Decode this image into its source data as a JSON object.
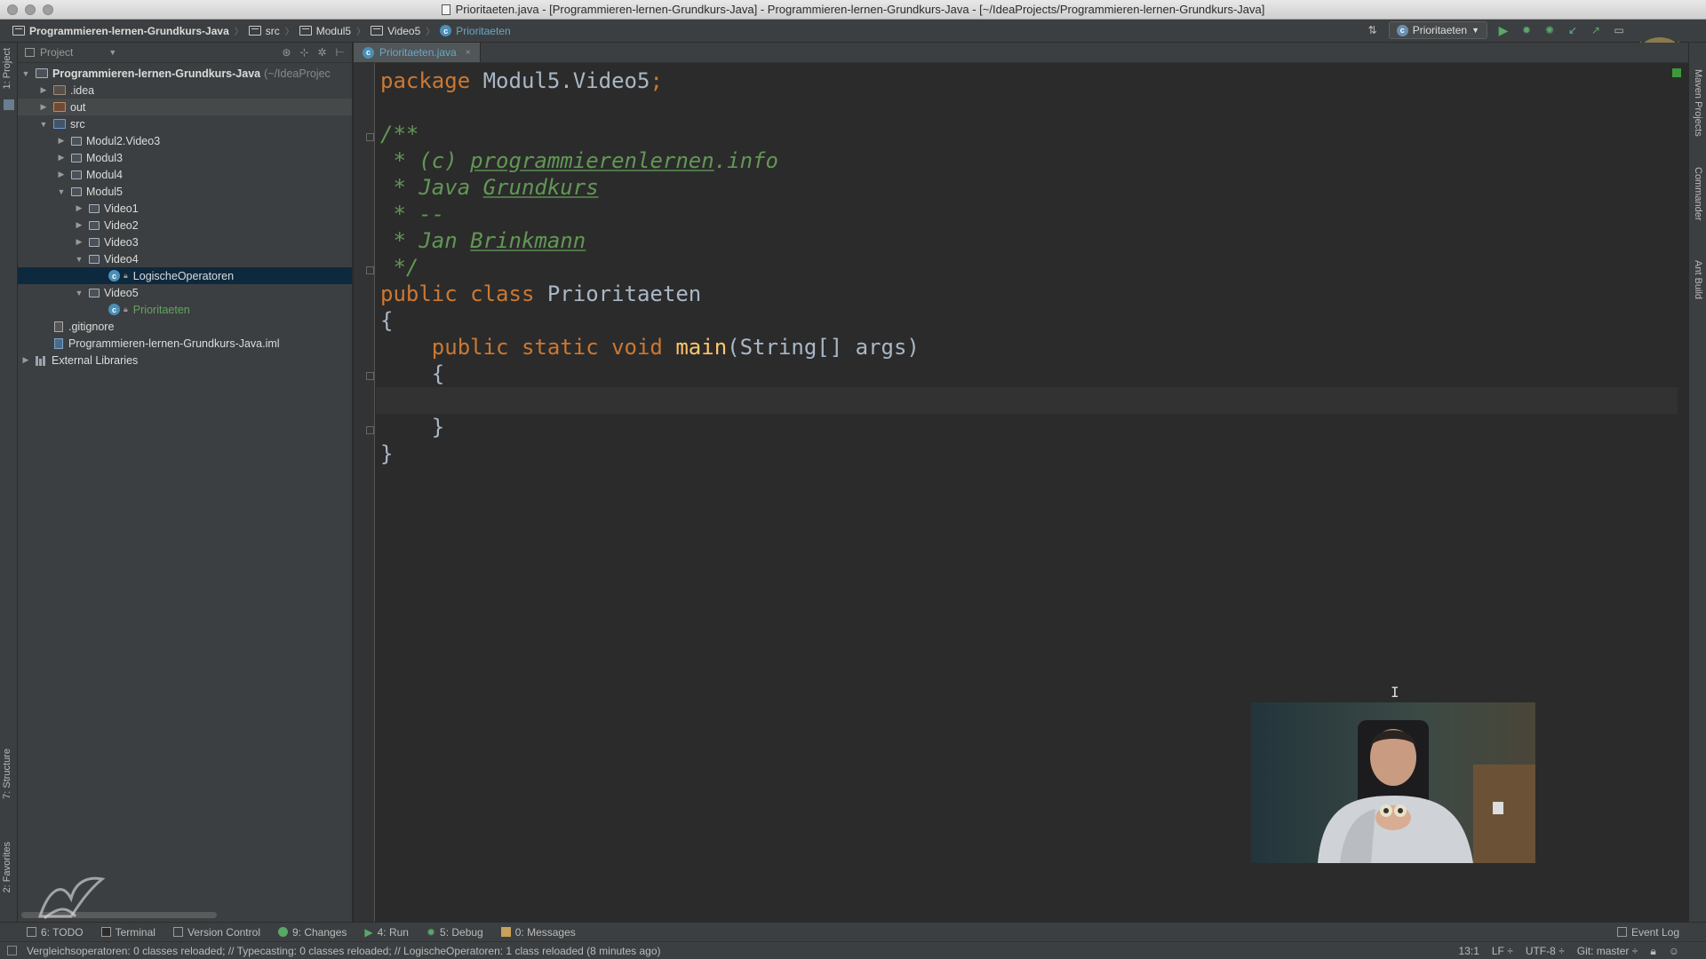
{
  "window": {
    "title": "Prioritaeten.java - [Programmieren-lernen-Grundkurs-Java] - Programmieren-lernen-Grundkurs-Java - [~/IdeaProjects/Programmieren-lernen-Grundkurs-Java]"
  },
  "navbar": {
    "crumbs": [
      "Programmieren-lernen-Grundkurs-Java",
      "src",
      "Modul5",
      "Video5",
      "Prioritaeten"
    ],
    "run_config": "Prioritaeten"
  },
  "project_panel": {
    "header": "Project",
    "root": "Programmieren-lernen-Grundkurs-Java",
    "root_path": "(~/IdeaProjec",
    "items": [
      ".idea",
      "out",
      "src",
      "Modul2.Video3",
      "Modul3",
      "Modul4",
      "Modul5",
      "Video1",
      "Video2",
      "Video3",
      "Video4",
      "LogischeOperatoren",
      "Video5",
      "Prioritaeten",
      ".gitignore",
      "Programmieren-lernen-Grundkurs-Java.iml",
      "External Libraries"
    ]
  },
  "editor": {
    "tab": "Prioritaeten.java",
    "code": {
      "l1_kw": "package",
      "l1_rest": " Modul5.Video5",
      "l1_semi": ";",
      "l3": "/**",
      "l4_a": " * (c) ",
      "l4_b": "programmierenlernen",
      "l4_c": ".info",
      "l5_a": " * Java ",
      "l5_b": "Grundkurs",
      "l6": " * --",
      "l7_a": " * Jan ",
      "l7_b": "Brinkmann",
      "l8": " */",
      "l9_kw": "public class",
      "l9_name": " Prioritaeten",
      "l10": "{",
      "l11_kw": "    public static void",
      "l11_fn": " main",
      "l11_rest": "(String[] args)",
      "l12": "    {",
      "l14": "    }",
      "l15": "}"
    }
  },
  "tool_windows": {
    "todo": "6: TODO",
    "terminal": "Terminal",
    "vcs": "Version Control",
    "changes": "9: Changes",
    "run": "4: Run",
    "debug": "5: Debug",
    "messages": "0: Messages",
    "event_log": "Event Log"
  },
  "left_stripe": {
    "project": "1: Project",
    "structure": "7: Structure",
    "favorites": "2: Favorites"
  },
  "right_stripe": {
    "maven": "Maven Projects",
    "commander": "Commander",
    "ant": "Ant Build"
  },
  "status": {
    "message": "Vergleichsoperatoren: 0 classes reloaded; // Typecasting: 0 classes reloaded; // LogischeOperatoren: 1 class reloaded (8 minutes ago)",
    "position": "13:1",
    "line_sep": "LF ÷",
    "encoding": "UTF-8 ÷",
    "git": "Git: master ÷"
  }
}
